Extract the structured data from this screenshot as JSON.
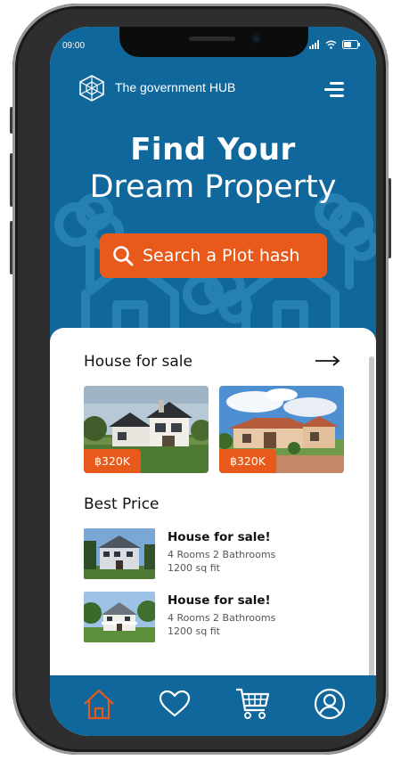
{
  "status_bar": {
    "time": "09:00"
  },
  "header": {
    "brand": "The government HUB",
    "logo_icon": "hexagon-logo-icon",
    "menu_icon": "menu-icon"
  },
  "hero": {
    "title_line1": "Find Your",
    "title_line2": "Dream Property",
    "search_button_label": "Search a Plot hash"
  },
  "sections": {
    "house_for_sale": {
      "title": "House for sale",
      "listings": [
        {
          "price": "฿320K"
        },
        {
          "price": "฿320K"
        }
      ]
    },
    "best_price": {
      "title": "Best Price",
      "items": [
        {
          "title": "House for sale!",
          "details": "4 Rooms  2 Bathrooms",
          "area": "1200 sq fit"
        },
        {
          "title": "House for sale!",
          "details": "4 Rooms  2 Bathrooms",
          "area": "1200 sq fit"
        }
      ]
    }
  },
  "bottom_nav": {
    "items": [
      "home-icon",
      "heart-icon",
      "cart-icon",
      "profile-icon"
    ],
    "active": "home-icon"
  },
  "colors": {
    "primary_blue": "#10679c",
    "accent_orange": "#e85a1c"
  }
}
